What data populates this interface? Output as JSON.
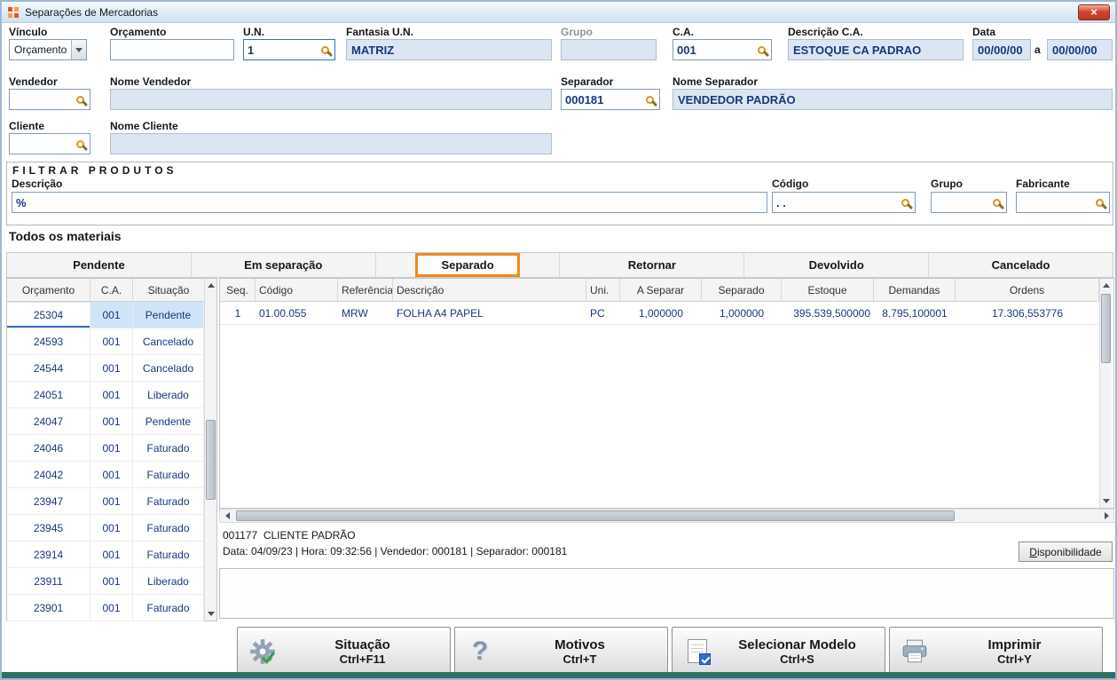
{
  "window": {
    "title": "Separações de Mercadorias"
  },
  "icons": {
    "close": "×",
    "question": "?"
  },
  "colors": {
    "accent_orange": "#EF8A1E",
    "value_text": "#17387E",
    "readonly_bg": "#DCE6F2",
    "selected_row": "#CFE4F8",
    "bottom_bar": "#2E7266"
  },
  "header_fields": {
    "vinculo": {
      "label": "Vínculo",
      "value": "Orçamento"
    },
    "orcamento": {
      "label": "Orçamento",
      "value": ""
    },
    "un": {
      "label": "U.N.",
      "value": "1"
    },
    "fantasia_un": {
      "label": "Fantasia U.N.",
      "value": "MATRIZ"
    },
    "grupo": {
      "label": "Grupo",
      "value": ""
    },
    "ca": {
      "label": "C.A.",
      "value": "001"
    },
    "descricao_ca": {
      "label": "Descrição C.A.",
      "value": "ESTOQUE CA PADRAO"
    },
    "data": {
      "label": "Data",
      "from": "00/00/00",
      "separator": "a",
      "to": "00/00/00"
    },
    "vendedor": {
      "label": "Vendedor",
      "value": ""
    },
    "nome_vendedor": {
      "label": "Nome Vendedor",
      "value": ""
    },
    "separador": {
      "label": "Separador",
      "value": "000181"
    },
    "nome_separador": {
      "label": "Nome Separador",
      "value": "VENDEDOR PADRÃO"
    },
    "cliente": {
      "label": "Cliente",
      "value": ""
    },
    "nome_cliente": {
      "label": "Nome Cliente",
      "value": ""
    }
  },
  "filter": {
    "title": "FILTRAR PRODUTOS",
    "descricao": {
      "label": "Descrição",
      "value": "%"
    },
    "codigo": {
      "label": "Código",
      "value": ". ."
    },
    "grupo": {
      "label": "Grupo",
      "value": ""
    },
    "fabricante": {
      "label": "Fabricante",
      "value": ""
    },
    "scope_note": "Todos os materiais"
  },
  "tabs": [
    {
      "label": "Pendente",
      "active": false
    },
    {
      "label": "Em separação",
      "active": false
    },
    {
      "label": "Separado",
      "active": true
    },
    {
      "label": "Retornar",
      "active": false
    },
    {
      "label": "Devolvido",
      "active": false
    },
    {
      "label": "Cancelado",
      "active": false
    }
  ],
  "orders_table": {
    "columns": [
      "Orçamento",
      "C.A.",
      "Situação"
    ],
    "rows": [
      {
        "orcamento": "25304",
        "ca": "001",
        "situacao": "Pendente",
        "selected": true
      },
      {
        "orcamento": "24593",
        "ca": "001",
        "situacao": "Cancelado",
        "selected": false
      },
      {
        "orcamento": "24544",
        "ca": "001",
        "situacao": "Cancelado",
        "selected": false
      },
      {
        "orcamento": "24051",
        "ca": "001",
        "situacao": "Liberado",
        "selected": false
      },
      {
        "orcamento": "24047",
        "ca": "001",
        "situacao": "Pendente",
        "selected": false
      },
      {
        "orcamento": "24046",
        "ca": "001",
        "situacao": "Faturado",
        "selected": false
      },
      {
        "orcamento": "24042",
        "ca": "001",
        "situacao": "Faturado",
        "selected": false
      },
      {
        "orcamento": "23947",
        "ca": "001",
        "situacao": "Faturado",
        "selected": false
      },
      {
        "orcamento": "23945",
        "ca": "001",
        "situacao": "Faturado",
        "selected": false
      },
      {
        "orcamento": "23914",
        "ca": "001",
        "situacao": "Faturado",
        "selected": false
      },
      {
        "orcamento": "23911",
        "ca": "001",
        "situacao": "Liberado",
        "selected": false
      },
      {
        "orcamento": "23901",
        "ca": "001",
        "situacao": "Faturado",
        "selected": false
      }
    ]
  },
  "items_table": {
    "columns": [
      "Seq.",
      "Código",
      "Referência",
      "Descrição",
      "Uni.",
      "A Separar",
      "Separado",
      "Estoque",
      "Demandas",
      "Ordens"
    ],
    "rows": [
      {
        "seq": "1",
        "codigo": "01.00.055",
        "referencia": "MRW",
        "descricao": "FOLHA A4 PAPEL",
        "uni": "PC",
        "a_separar": "1,000000",
        "separado": "1,000000",
        "estoque": "395.539,500000",
        "demandas": "8.795,100001",
        "ordens": "17.306,553776"
      }
    ]
  },
  "detail": {
    "client_line": "001177  CLIENTE PADRÃO",
    "info_line": "Data: 04/09/23 | Hora: 09:32:56 | Vendedor: 000181 | Separador: 000181",
    "disponibilidade": {
      "accel": "D",
      "rest": "isponibilidade"
    }
  },
  "actions": [
    {
      "label": "Situação",
      "shortcut": "Ctrl+F11",
      "icon": "gear-check-icon"
    },
    {
      "label": "Motivos",
      "shortcut": "Ctrl+T",
      "icon": "question-icon"
    },
    {
      "label": "Selecionar Modelo",
      "shortcut": "Ctrl+S",
      "icon": "document-check-icon"
    },
    {
      "label": "Imprimir",
      "shortcut": "Ctrl+Y",
      "icon": "printer-icon"
    }
  ]
}
